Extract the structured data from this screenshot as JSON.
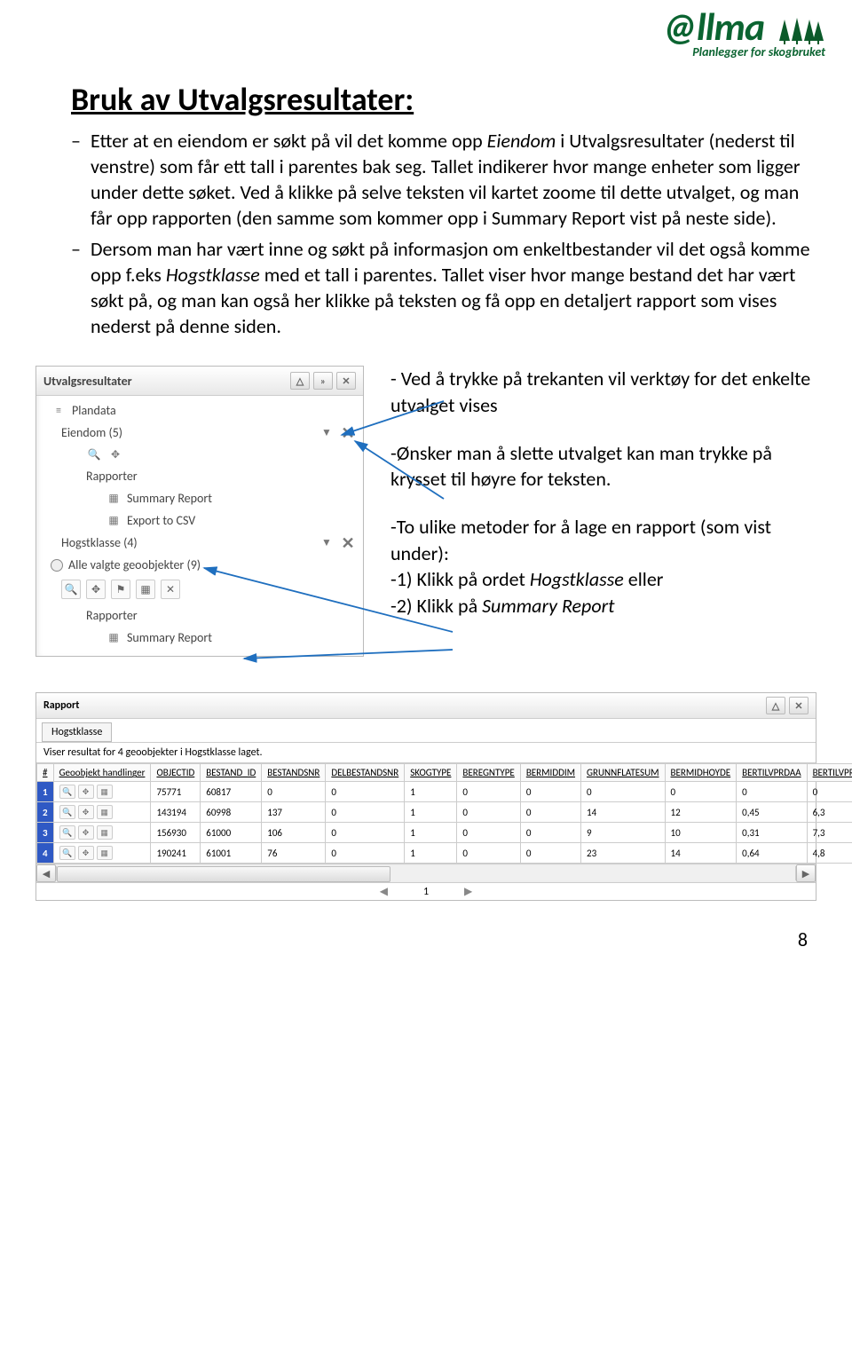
{
  "logo": {
    "brand": "@llma",
    "tagline": "Planlegger for skogbruket"
  },
  "title": "Bruk av Utvalgsresultater:",
  "para1": {
    "p1a": "Etter at en eiendom er søkt på vil det komme opp ",
    "p1b": "Eiendom",
    "p1c": " i Utvalgsresultater (nederst til venstre) som får ett tall i parentes bak seg. Tallet indikerer hvor mange enheter som ligger under dette søket. Ved å klikke på selve teksten vil kartet zoome til dette utvalget, og man får opp rapporten (den samme som kommer opp i Summary Report vist på neste side)."
  },
  "para2": {
    "p2a": "Dersom man har vært inne og søkt på informasjon om enkeltbestander vil det også komme opp f.eks ",
    "p2b": "Hogstklasse",
    "p2c": " med et tall i parentes. Tallet viser hvor mange bestand det har vært søkt på, og man kan også her klikke på teksten og få opp en detaljert rapport som vises nederst på denne siden."
  },
  "panel": {
    "header": "Utvalgsresultater",
    "plandata": "Plandata",
    "eiendom": "Eiendom (5)",
    "rapporter1": "Rapporter",
    "summary1": "Summary Report",
    "export": "Export to CSV",
    "hogst": "Hogstklasse (4)",
    "alle": "Alle valgte geoobjekter (9)",
    "rapporter2": "Rapporter",
    "summary2": "Summary Report"
  },
  "notes": {
    "n1": "- Ved å trykke på trekanten vil verktøy for det enkelte utvalget vises",
    "n2": "-Ønsker man å slette utvalget kan man trykke på krysset til høyre for teksten.",
    "n3a": "-To ulike metoder for å lage en rapport (som vist under):",
    "n3b": "-1) Klikk på ordet ",
    "n3b_i": "Hogstklasse",
    "n3c": " eller",
    "n3d": "-2) Klikk på ",
    "n3d_i": "Summary Report"
  },
  "report": {
    "title": "Rapport",
    "tab": "Hogstklasse",
    "subtitle": "Viser resultat for 4 geoobjekter i Hogstklasse laget.",
    "headers": [
      "#",
      "Geoobjekt handlinger",
      "OBJECTID",
      "BESTAND_ID",
      "BESTANDSNR",
      "DELBESTANDSNR",
      "SKOGTYPE",
      "BEREGNTYPE",
      "BERMIDDIM",
      "GRUNNFLATESUM",
      "BERMIDHOYDE",
      "BERTILVPRDAA",
      "BERTILVPROS"
    ],
    "rows": [
      {
        "n": "1",
        "objid": "75771",
        "bid": "60817",
        "bnr": "0",
        "del": "0",
        "skog": "1",
        "ber": "0",
        "bmd": "0",
        "gfs": "0",
        "bmh": "0",
        "tvd": "0",
        "tvp": "0"
      },
      {
        "n": "2",
        "objid": "143194",
        "bid": "60998",
        "bnr": "137",
        "del": "0",
        "skog": "1",
        "ber": "0",
        "bmd": "0",
        "gfs": "14",
        "bmh": "12",
        "tvd": "0,45",
        "tvp": "6,3"
      },
      {
        "n": "3",
        "objid": "156930",
        "bid": "61000",
        "bnr": "106",
        "del": "0",
        "skog": "1",
        "ber": "0",
        "bmd": "0",
        "gfs": "9",
        "bmh": "10",
        "tvd": "0,31",
        "tvp": "7,3"
      },
      {
        "n": "4",
        "objid": "190241",
        "bid": "61001",
        "bnr": "76",
        "del": "0",
        "skog": "1",
        "ber": "0",
        "bmd": "0",
        "gfs": "23",
        "bmh": "14",
        "tvd": "0,64",
        "tvp": "4,8"
      }
    ],
    "page": "1"
  },
  "pagenum": "8"
}
